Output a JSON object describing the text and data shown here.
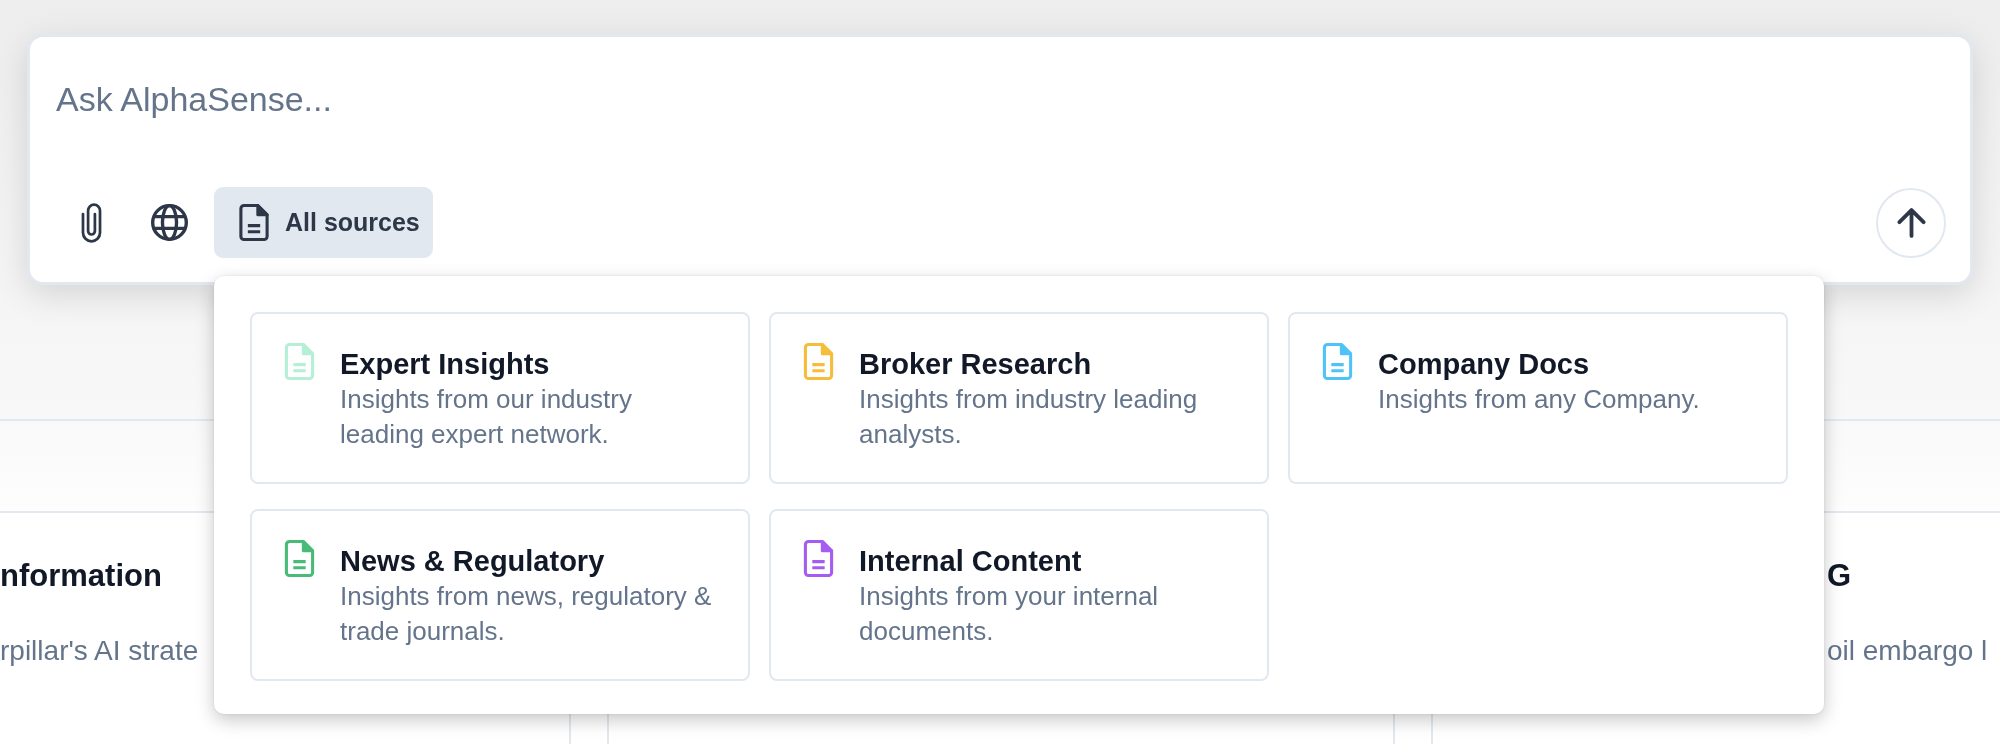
{
  "chat_input": {
    "placeholder": "Ask AlphaSense..."
  },
  "toolbar": {
    "sources_button": {
      "label": "All sources",
      "expanded": true
    }
  },
  "sources_menu": [
    {
      "title": "Expert Insights",
      "description": "Insights from our industry leading expert network.",
      "color": "#b4efd6"
    },
    {
      "title": "Broker Research",
      "description": "Insights from industry leading analysts.",
      "color": "#f6bd3b"
    },
    {
      "title": "Company Docs",
      "description": "Insights from any Company.",
      "color": "#4fc3f7"
    },
    {
      "title": "News & Regulatory",
      "description": "Insights from news, regulatory & trade journals.",
      "color": "#48bb78"
    },
    {
      "title": "Internal Content",
      "description": "Insights from your internal documents.",
      "color": "#a55cf0"
    }
  ],
  "background": {
    "left_card": {
      "title": "nformation",
      "text": "rpillar's AI strate"
    },
    "right_card": {
      "title": "G",
      "text": "oil embargo l"
    }
  }
}
